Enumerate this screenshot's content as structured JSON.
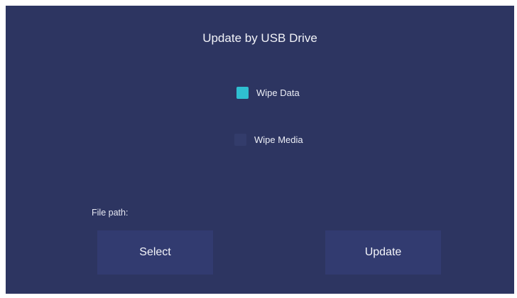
{
  "window": {
    "title": "Update by USB Drive"
  },
  "options": [
    {
      "label": "Wipe Data",
      "checked": true
    },
    {
      "label": "Wipe Media",
      "checked": false
    }
  ],
  "file_path": {
    "label": "File path:"
  },
  "buttons": {
    "select_label": "Select",
    "update_label": "Update"
  },
  "colors": {
    "background": "#2d3561",
    "button": "#323b70",
    "checkbox_checked": "#2fbfd0",
    "checkbox_unchecked": "#333c6b"
  }
}
